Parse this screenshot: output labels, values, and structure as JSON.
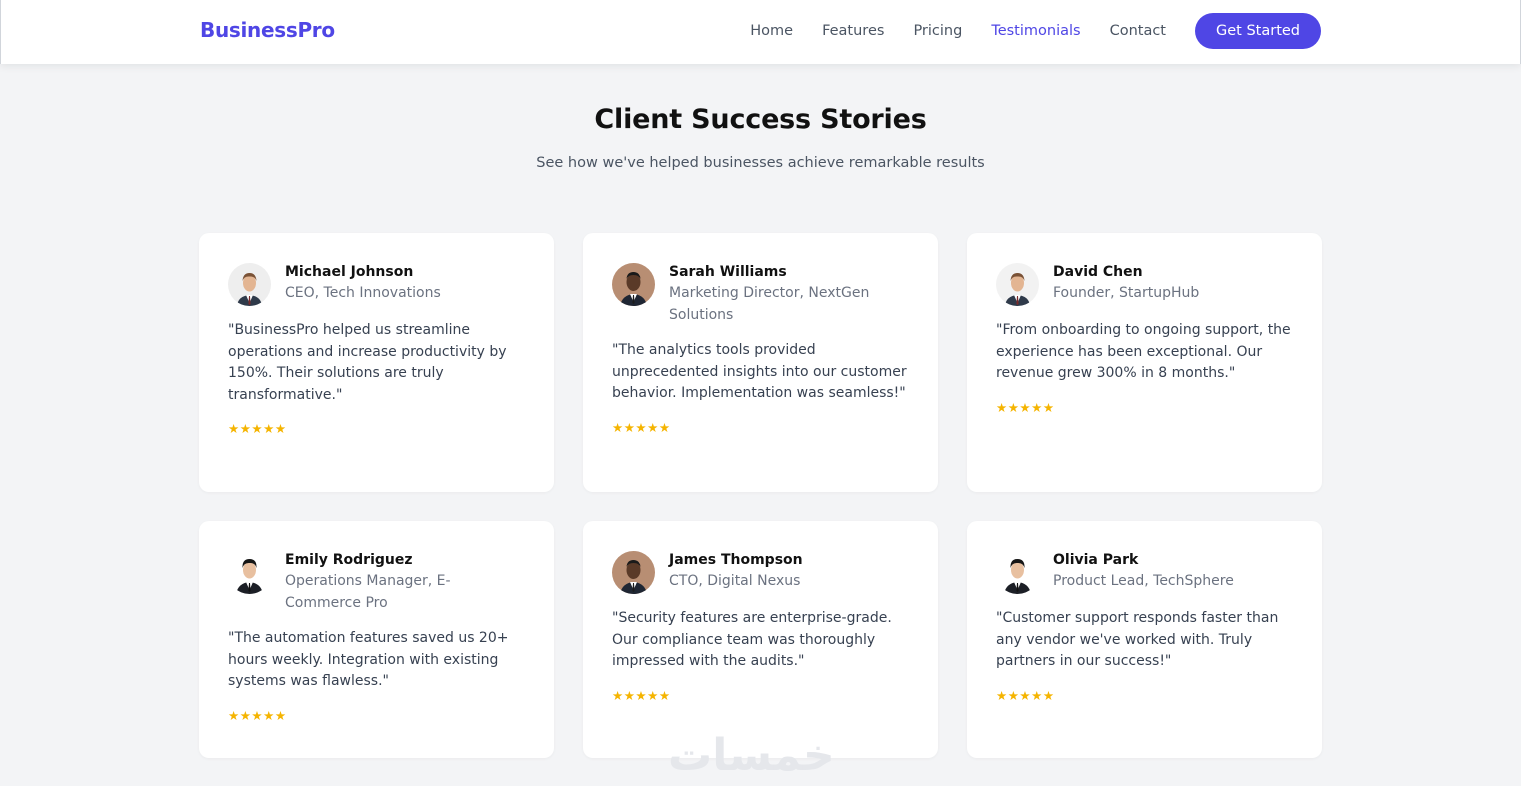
{
  "nav": {
    "brand": "BusinessPro",
    "links": [
      "Home",
      "Features",
      "Pricing",
      "Testimonials",
      "Contact"
    ],
    "active": "Testimonials",
    "cta": "Get Started"
  },
  "hero": {
    "title": "Client Success Stories",
    "subtitle": "See how we've helped businesses achieve remarkable results"
  },
  "testimonials": [
    {
      "name": "Michael Johnson",
      "role": "CEO, Tech Innovations",
      "quote": "\"BusinessPro helped us streamline operations and increase productivity by 150%. Their solutions are truly transformative.\"",
      "stars": "★★★★★",
      "rating": 5,
      "avatar": "light-skin-man"
    },
    {
      "name": "Sarah Williams",
      "role": "Marketing Director, NextGen Solutions",
      "quote": "\"The analytics tools provided unprecedented insights into our customer behavior. Implementation was seamless!\"",
      "stars": "★★★★★",
      "rating": 5,
      "avatar": "dark-skin-man"
    },
    {
      "name": "David Chen",
      "role": "Founder, StartupHub",
      "quote": "\"From onboarding to ongoing support, the experience has been exceptional. Our revenue grew 300% in 8 months.\"",
      "stars": "★★★★★",
      "rating": 5,
      "avatar": "light-skin-man"
    },
    {
      "name": "Emily Rodriguez",
      "role": "Operations Manager, E-Commerce Pro",
      "quote": "\"The automation features saved us 20+ hours weekly. Integration with existing systems was flawless.\"",
      "stars": "★★★★★",
      "rating": 5,
      "avatar": "dark-hair-man"
    },
    {
      "name": "James Thompson",
      "role": "CTO, Digital Nexus",
      "quote": "\"Security features are enterprise-grade. Our compliance team was thoroughly impressed with the audits.\"",
      "stars": "★★★★★",
      "rating": 5,
      "avatar": "dark-skin-man"
    },
    {
      "name": "Olivia Park",
      "role": "Product Lead, TechSphere",
      "quote": "\"Customer support responds faster than any vendor we've worked with. Truly partners in our success!\"",
      "stars": "★★★★★",
      "rating": 5,
      "avatar": "dark-hair-man"
    }
  ],
  "colors": {
    "accent": "#4f46e5",
    "star": "#f5b400",
    "background": "#f3f4f6",
    "card": "#ffffff"
  },
  "watermark": "خمسات"
}
